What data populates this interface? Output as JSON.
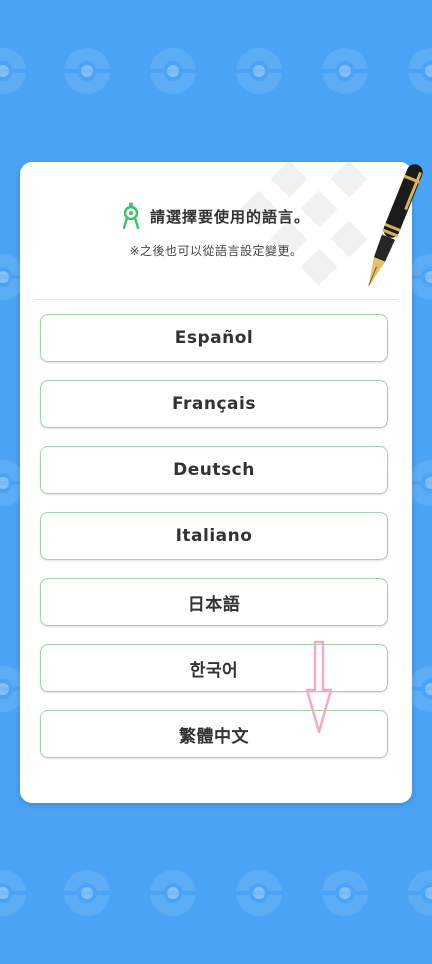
{
  "dialog": {
    "title": "請選擇要使用的語言。",
    "subtitle": "※之後也可以從語言設定變更。"
  },
  "languages": [
    {
      "label": "Español"
    },
    {
      "label": "Français"
    },
    {
      "label": "Deutsch"
    },
    {
      "label": "Italiano"
    },
    {
      "label": "日本語"
    },
    {
      "label": "한국어"
    },
    {
      "label": "繁體中文"
    }
  ],
  "icons": {
    "title_icon": "compass-icon",
    "decoration": "fountain-pen-icon",
    "overlay": "down-arrow-icon"
  },
  "colors": {
    "background": "#4aa3f5",
    "button_border": "#9fd6a8",
    "icon_green": "#3cc46b",
    "overlay_arrow": "#f7a9cc"
  }
}
